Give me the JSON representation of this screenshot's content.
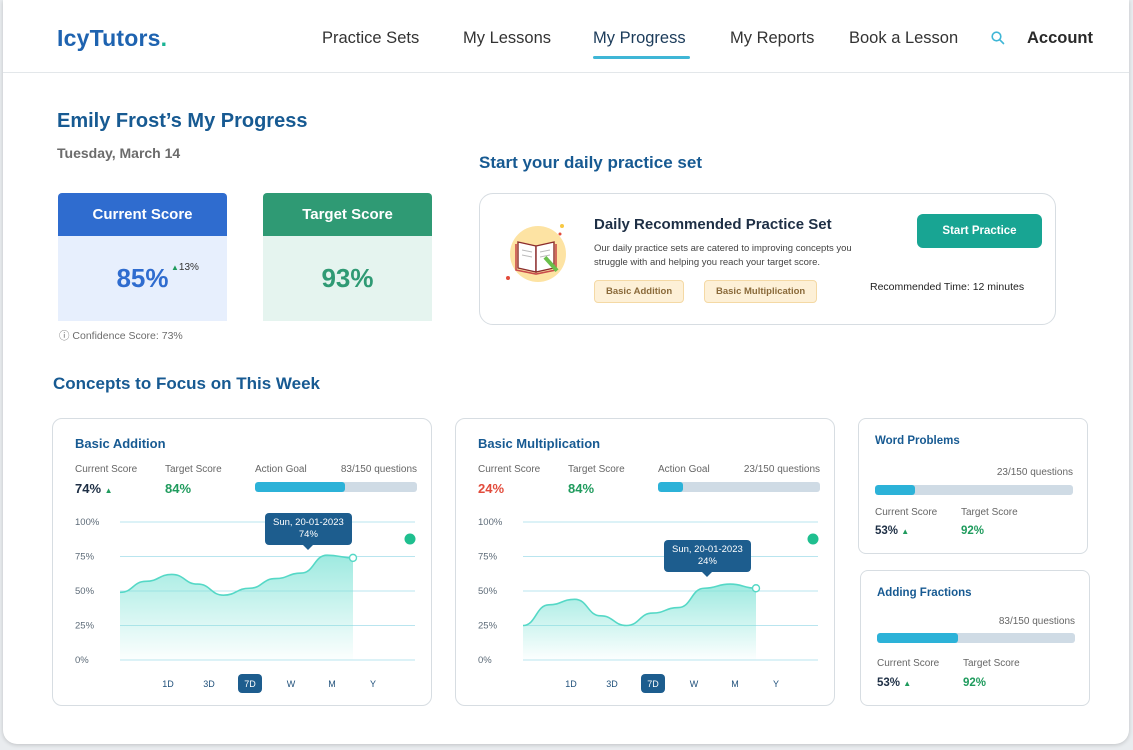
{
  "brand": {
    "name": "IcyTutors",
    "dot": ".",
    "primary": "#1e63b0",
    "accent": "#19b394"
  },
  "nav": {
    "items": [
      "Practice Sets",
      "My Lessons",
      "My Progress",
      "My Reports",
      "Book a Lesson"
    ],
    "active": "My Progress",
    "search_icon": "search-icon",
    "account": "Account"
  },
  "page": {
    "title": "Emily Frost’s My Progress",
    "date": "Tuesday, March 14"
  },
  "scores": {
    "current": {
      "label": "Current Score",
      "value": "85%",
      "delta": "13%",
      "color": "#2f6ccf"
    },
    "target": {
      "label": "Target Score",
      "value": "93%",
      "color": "#2f9a74"
    },
    "confidence": "Confidence Score: 73%"
  },
  "practice": {
    "heading": "Start your daily practice set",
    "title": "Daily Recommended Practice Set",
    "description": "Our daily practice sets are catered to improving concepts you struggle with and helping you reach your target score.",
    "tags": [
      "Basic Addition",
      "Basic Multiplication"
    ],
    "button": "Start Practice",
    "time": "Recommended Time: 12 minutes"
  },
  "concepts": {
    "heading": "Concepts to Focus on This Week",
    "labels": {
      "current": "Current Score",
      "target": "Target Score",
      "goal": "Action Goal"
    },
    "y_ticks": [
      "100%",
      "75%",
      "50%",
      "25%",
      "0%"
    ],
    "timeframes": [
      "1D",
      "3D",
      "7D",
      "W",
      "M",
      "Y"
    ],
    "active_timeframe": "7D",
    "cards": [
      {
        "title": "Basic Addition",
        "current": "74%",
        "current_trend": "up",
        "target": "84%",
        "questions": "83/150 questions",
        "goal_progress": 0.553,
        "tooltip_date": "Sun, 20-01-2023",
        "tooltip_value": "74%",
        "chart_data": {
          "type": "area",
          "ylim": [
            0,
            100
          ],
          "values": [
            49,
            57,
            62,
            55,
            47,
            52,
            59,
            63,
            76,
            74
          ]
        }
      },
      {
        "title": "Basic Multiplication",
        "current": "24%",
        "current_trend": "down",
        "target": "84%",
        "questions": "23/150 questions",
        "goal_progress": 0.153,
        "tooltip_date": "Sun, 20-01-2023",
        "tooltip_value": "24%",
        "chart_data": {
          "type": "area",
          "ylim": [
            0,
            100
          ],
          "values": [
            25,
            40,
            44,
            32,
            25,
            34,
            38,
            52,
            55,
            52
          ]
        }
      }
    ],
    "side": [
      {
        "title": "Word Problems",
        "questions": "23/150 questions",
        "goal_progress": 0.2,
        "current": "53%",
        "target": "92%"
      },
      {
        "title": "Adding Fractions",
        "questions": "83/150 questions",
        "goal_progress": 0.41,
        "current": "53%",
        "target": "92%"
      }
    ]
  },
  "colors": {
    "heading": "#175a92",
    "bad": "#e24b3b",
    "good": "#1f9b5d",
    "bar": "#2cb2d8",
    "track": "#cfdbe5",
    "area": "#7ee3d6",
    "dot": "#1fbf8f"
  }
}
